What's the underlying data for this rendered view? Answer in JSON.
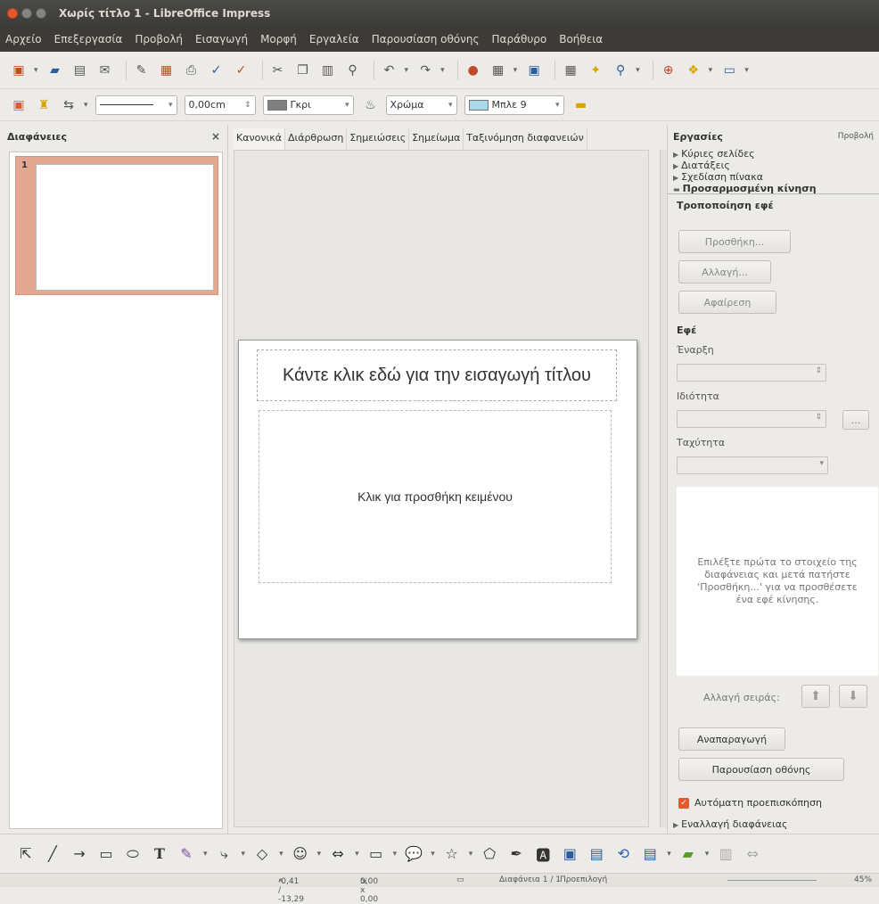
{
  "window": {
    "title": "Χωρίς τίτλο 1 - LibreOffice Impress"
  },
  "menu": [
    "Αρχείο",
    "Επεξεργασία",
    "Προβολή",
    "Εισαγωγή",
    "Μορφή",
    "Εργαλεία",
    "Παρουσίαση οθόνης",
    "Παράθυρο",
    "Βοήθεια"
  ],
  "toolbar2": {
    "line_width": "0,00cm",
    "line_color": "Γκρι",
    "area_style": "Χρώμα",
    "area_color": "Μπλε 9",
    "line_color_hex": "#808080",
    "area_color_hex": "#a8d8ea"
  },
  "slides_panel": {
    "title": "Διαφάνειες",
    "close_glyph": "×",
    "slide_number": "1"
  },
  "view_tabs": [
    "Κανονικά",
    "Διάρθρωση",
    "Σημειώσεις",
    "Σημείωμα",
    "Ταξινόμηση διαφανειών"
  ],
  "slide": {
    "title_placeholder": "Κάντε κλικ εδώ για την εισαγωγή τίτλου",
    "body_placeholder": "Κλικ για προσθήκη κειμένου"
  },
  "tasks_panel": {
    "title": "Εργασίες",
    "view_menu": "Προβολή",
    "sections": [
      "Κύριες σελίδες",
      "Διατάξεις",
      "Σχεδίαση πίνακα"
    ],
    "open_section": "Προσαρμοσμένη κίνηση",
    "modify_effect": "Τροποποίηση εφέ",
    "add_button": "Προσθήκη...",
    "change_button": "Αλλαγή...",
    "remove_button": "Αφαίρεση",
    "effect_label": "Εφέ",
    "start_label": "Έναρξη",
    "property_label": "Ιδιότητα",
    "speed_label": "Ταχύτητα",
    "info_text": "Επιλέξτε πρώτα το στοιχείο της διαφάνειας και μετά πατήστε 'Προσθήκη...' για να προσθέσετε ένα εφέ κίνησης.",
    "change_order": "Αλλαγή σειράς:",
    "play_button": "Αναπαραγωγή",
    "slideshow_button": "Παρουσίαση οθόνης",
    "auto_preview": "Αυτόματη προεπισκόπηση",
    "slide_transition": "Εναλλαγή διαφάνειας",
    "more_glyph": "..."
  },
  "statusbar": {
    "position": "-0,41 / -13,29",
    "size": "0,00 x 0,00",
    "slide": "Διαφάνεια 1 / 1",
    "layout": "Προεπιλογή",
    "zoom": "45%"
  },
  "accent_color": "#e4582d"
}
